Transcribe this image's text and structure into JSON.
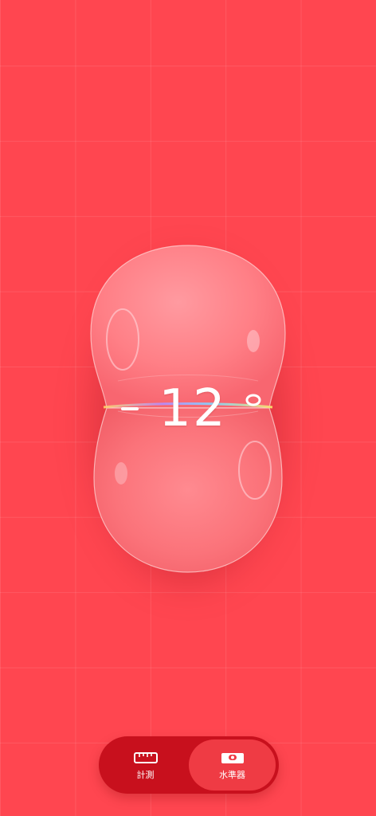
{
  "app": {
    "mode": "level"
  },
  "level": {
    "reading": "12",
    "unit": "°",
    "background_color": "#ff4650",
    "accent_color": "#ffffff"
  },
  "tabs": [
    {
      "label": "計測",
      "icon": "ruler-icon",
      "active": false
    },
    {
      "label": "水準器",
      "icon": "level-icon",
      "active": true
    }
  ],
  "colors": {
    "bar_background": "#c8101d",
    "active_segment": "#ef3b44"
  }
}
